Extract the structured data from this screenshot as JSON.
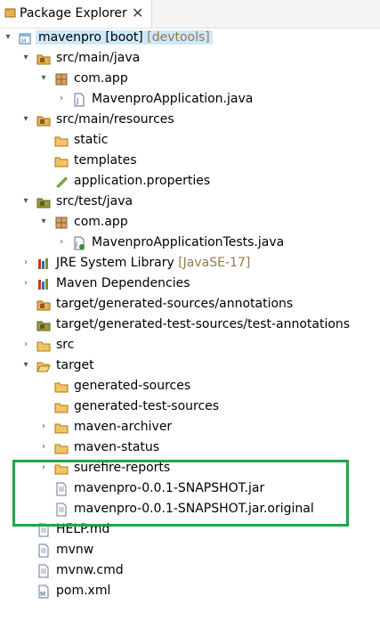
{
  "tab": {
    "title": "Package Explorer",
    "close_glyph": "✕"
  },
  "tree": [
    {
      "label": "mavenpro [boot]",
      "decoration": " [devtools]",
      "icon": "project-icon",
      "expanded": true
    },
    {
      "label": "src/main/java",
      "decoration": "",
      "icon": "source-folder-icon",
      "expanded": true
    },
    {
      "label": "com.app",
      "decoration": "",
      "icon": "package-icon",
      "expanded": true
    },
    {
      "label": "MavenproApplication.java",
      "decoration": "",
      "icon": "java-file-icon",
      "expanded": false
    },
    {
      "label": "src/main/resources",
      "decoration": "",
      "icon": "source-folder-icon",
      "expanded": true
    },
    {
      "label": "static",
      "decoration": "",
      "icon": "folder-icon",
      "expanded": null
    },
    {
      "label": "templates",
      "decoration": "",
      "icon": "folder-icon",
      "expanded": null
    },
    {
      "label": "application.properties",
      "decoration": "",
      "icon": "properties-file-icon",
      "expanded": null
    },
    {
      "label": "src/test/java",
      "decoration": "",
      "icon": "test-source-folder-icon",
      "expanded": true
    },
    {
      "label": "com.app",
      "decoration": "",
      "icon": "package-icon",
      "expanded": true
    },
    {
      "label": "MavenproApplicationTests.java",
      "decoration": "",
      "icon": "java-test-file-icon",
      "expanded": false
    },
    {
      "label": "JRE System Library",
      "decoration": " [JavaSE-17]",
      "icon": "library-icon",
      "expanded": false
    },
    {
      "label": "Maven Dependencies",
      "decoration": "",
      "icon": "library-icon",
      "expanded": false
    },
    {
      "label": "target/generated-sources/annotations",
      "decoration": "",
      "icon": "source-folder-icon",
      "expanded": null
    },
    {
      "label": "target/generated-test-sources/test-annotations",
      "decoration": "",
      "icon": "test-source-folder-icon",
      "expanded": null
    },
    {
      "label": "src",
      "decoration": "",
      "icon": "folder-icon",
      "expanded": false
    },
    {
      "label": "target",
      "decoration": "",
      "icon": "folder-open-icon",
      "expanded": true
    },
    {
      "label": "generated-sources",
      "decoration": "",
      "icon": "folder-icon",
      "expanded": null
    },
    {
      "label": "generated-test-sources",
      "decoration": "",
      "icon": "folder-icon",
      "expanded": null
    },
    {
      "label": "maven-archiver",
      "decoration": "",
      "icon": "folder-icon",
      "expanded": false
    },
    {
      "label": "maven-status",
      "decoration": "",
      "icon": "folder-icon",
      "expanded": false
    },
    {
      "label": "surefire-reports",
      "decoration": "",
      "icon": "folder-icon",
      "expanded": false
    },
    {
      "label": "mavenpro-0.0.1-SNAPSHOT.jar",
      "decoration": "",
      "icon": "file-icon",
      "expanded": null
    },
    {
      "label": "mavenpro-0.0.1-SNAPSHOT.jar.original",
      "decoration": "",
      "icon": "file-icon",
      "expanded": null
    },
    {
      "label": "HELP.md",
      "decoration": "",
      "icon": "file-icon",
      "expanded": null
    },
    {
      "label": "mvnw",
      "decoration": "",
      "icon": "file-icon",
      "expanded": null
    },
    {
      "label": "mvnw.cmd",
      "decoration": "",
      "icon": "file-icon",
      "expanded": null
    },
    {
      "label": "pom.xml",
      "decoration": "",
      "icon": "xml-file-icon",
      "expanded": null
    }
  ],
  "colors": {
    "highlight_box": "#25a24a",
    "selection": "#cfe8fc",
    "decoration_text": "#96784a"
  }
}
